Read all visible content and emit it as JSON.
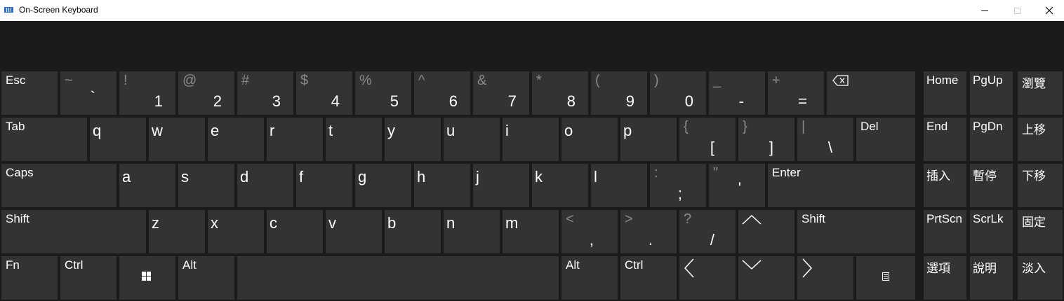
{
  "window": {
    "title": "On-Screen Keyboard"
  },
  "keys": {
    "esc": "Esc",
    "tab": "Tab",
    "caps": "Caps",
    "shift_left": "Shift",
    "shift_right": "Shift",
    "fn": "Fn",
    "ctrl_left": "Ctrl",
    "ctrl_right": "Ctrl",
    "alt_left": "Alt",
    "alt_right": "Alt",
    "del": "Del",
    "enter": "Enter",
    "home": "Home",
    "pgup": "PgUp",
    "end": "End",
    "pgdn": "PgDn",
    "prtscn": "PrtScn",
    "scrlk": "ScrLk",
    "browse": "瀏覽",
    "move_up": "上移",
    "insert": "插入",
    "pause": "暫停",
    "move_down": "下移",
    "dock": "固定",
    "options": "選項",
    "help": "說明",
    "fade": "淡入"
  },
  "number_row": [
    {
      "shift": "~",
      "base": "`"
    },
    {
      "shift": "!",
      "base": "1"
    },
    {
      "shift": "@",
      "base": "2"
    },
    {
      "shift": "#",
      "base": "3"
    },
    {
      "shift": "$",
      "base": "4"
    },
    {
      "shift": "%",
      "base": "5"
    },
    {
      "shift": "^",
      "base": "6"
    },
    {
      "shift": "&",
      "base": "7"
    },
    {
      "shift": "*",
      "base": "8"
    },
    {
      "shift": "(",
      "base": "9"
    },
    {
      "shift": ")",
      "base": "0"
    },
    {
      "shift": "_",
      "base": "-"
    },
    {
      "shift": "+",
      "base": "="
    }
  ],
  "q_row": [
    "q",
    "w",
    "e",
    "r",
    "t",
    "y",
    "u",
    "i",
    "o",
    "p"
  ],
  "q_row_sym": [
    {
      "shift": "{",
      "base": "["
    },
    {
      "shift": "}",
      "base": "]"
    },
    {
      "shift": "|",
      "base": "\\"
    }
  ],
  "a_row": [
    "a",
    "s",
    "d",
    "f",
    "g",
    "h",
    "j",
    "k",
    "l"
  ],
  "a_row_sym": [
    {
      "shift": ":",
      "base": ";"
    },
    {
      "shift": "\"",
      "base": "'"
    }
  ],
  "z_row": [
    "z",
    "x",
    "c",
    "v",
    "b",
    "n",
    "m"
  ],
  "z_row_sym": [
    {
      "shift": "<",
      "base": ","
    },
    {
      "shift": ">",
      "base": "."
    },
    {
      "shift": "?",
      "base": "/"
    }
  ],
  "icons": {
    "backspace": "backspace-icon",
    "windows": "windows-logo-icon",
    "arrow_up": "arrow-up-icon",
    "arrow_left": "arrow-left-icon",
    "arrow_down": "arrow-down-icon",
    "arrow_right": "arrow-right-icon",
    "menu": "context-menu-icon"
  },
  "colors": {
    "key": "#333333",
    "background": "#1b1b1b",
    "shift_symbol": "#8a8a8a"
  }
}
